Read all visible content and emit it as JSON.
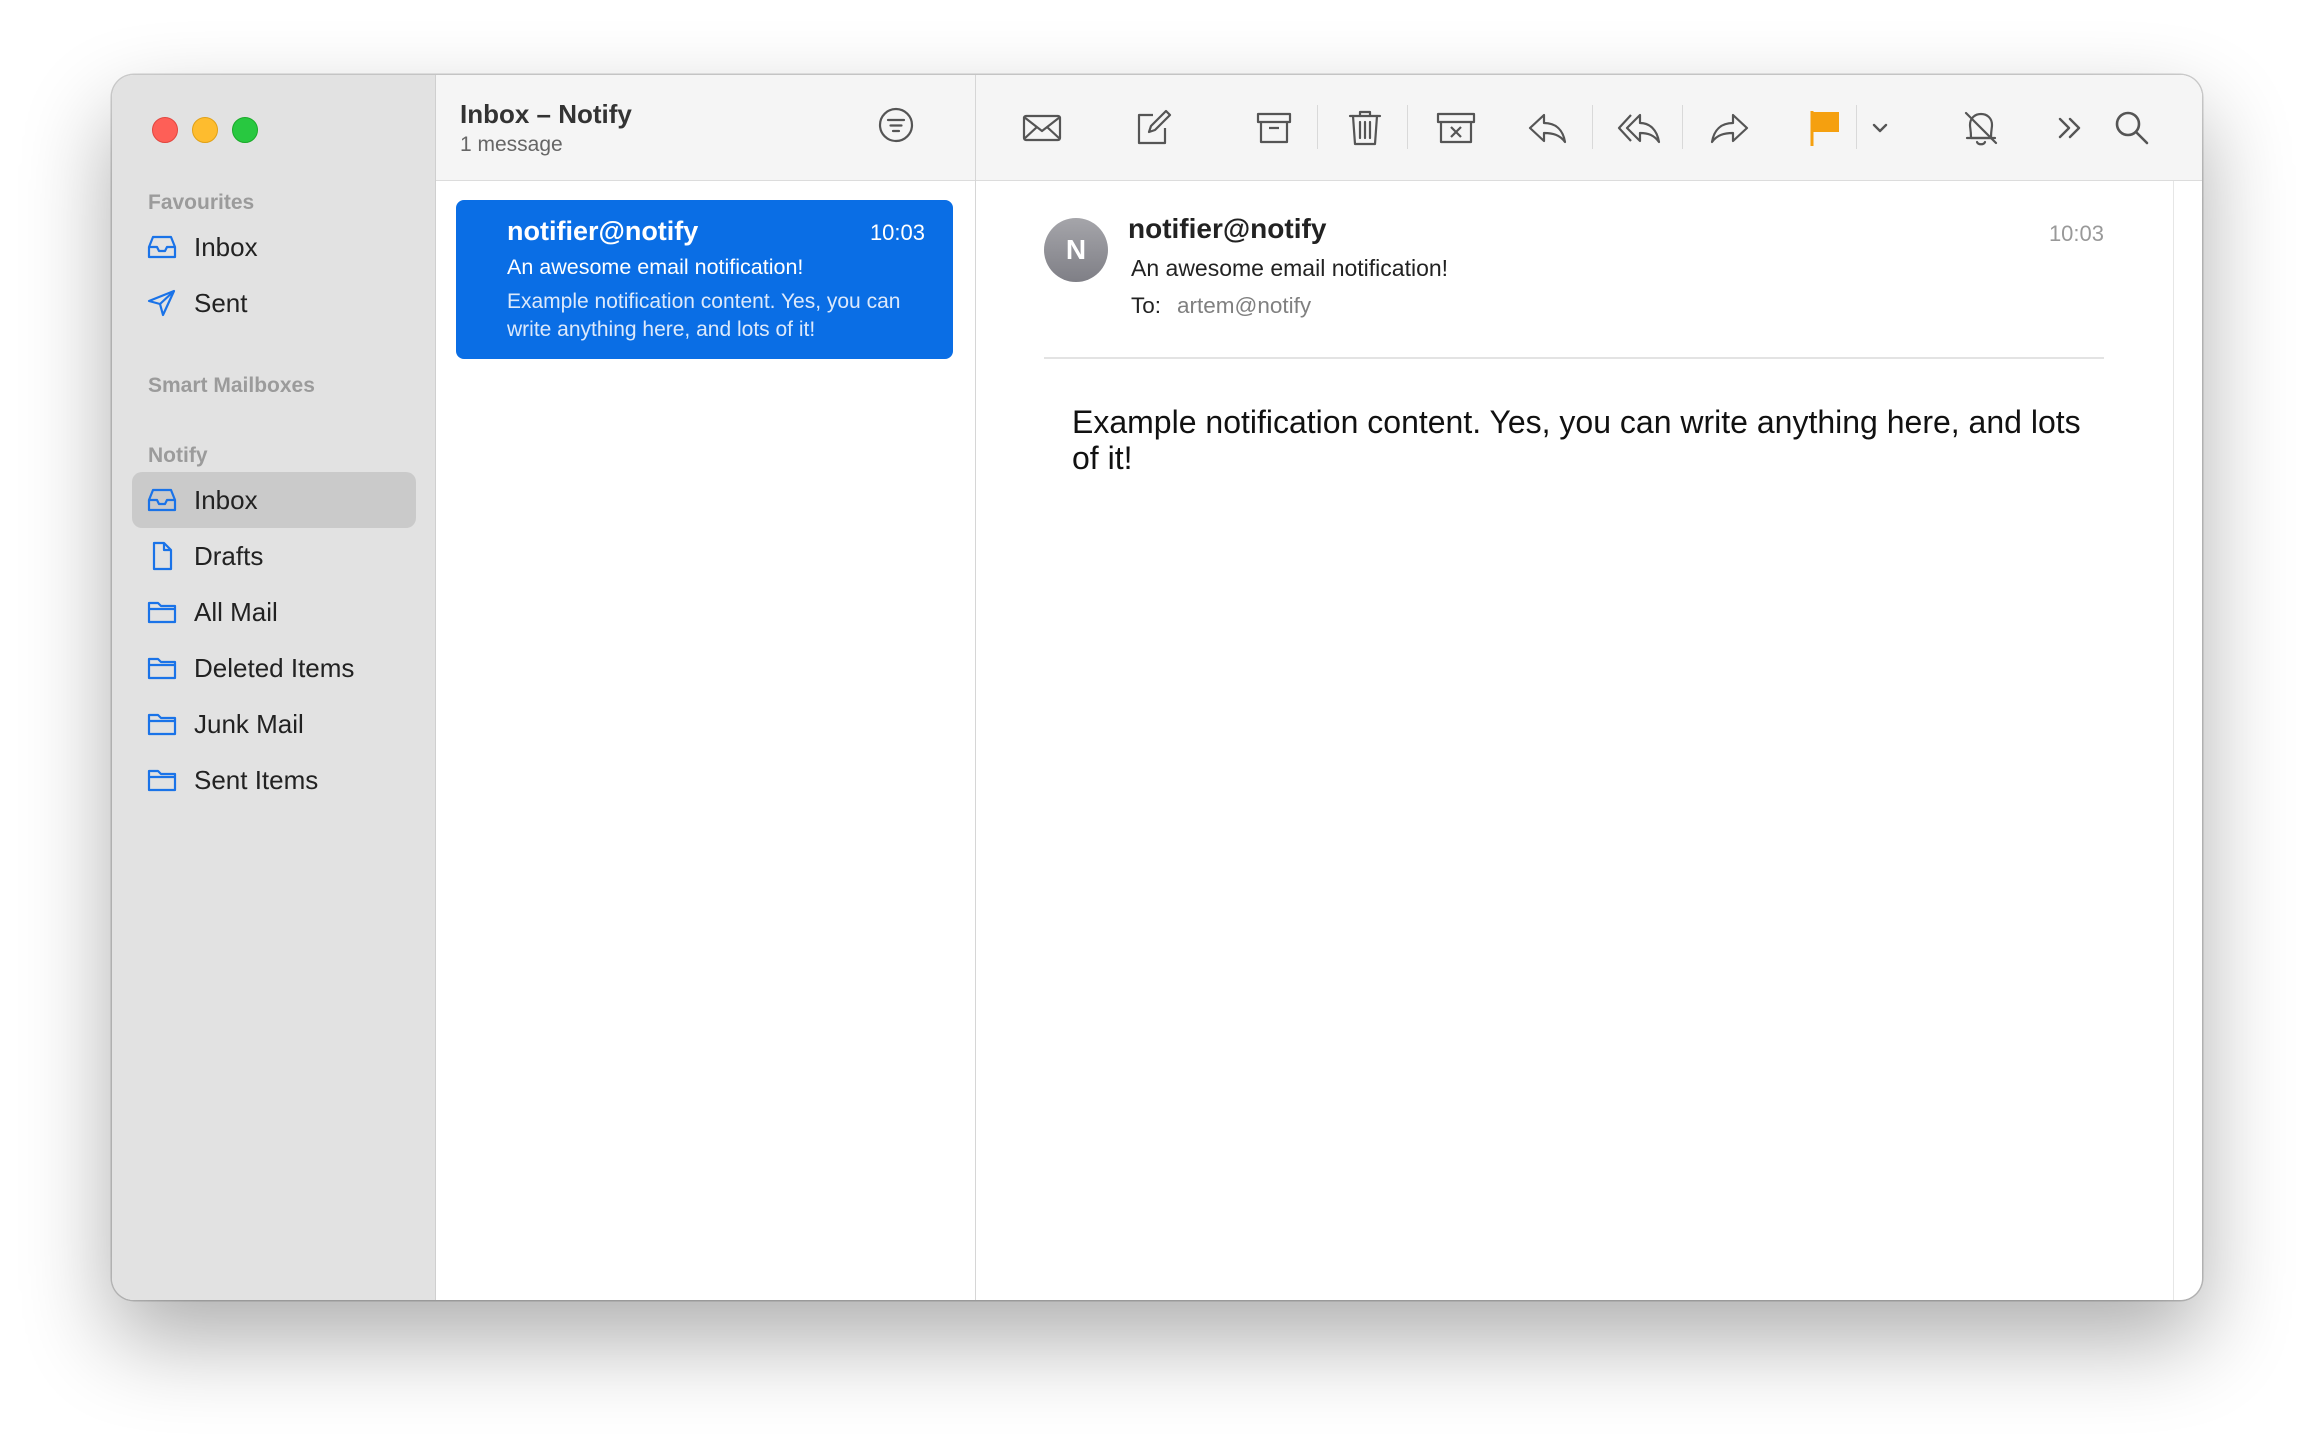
{
  "window": {
    "traffic_lights": [
      "close",
      "minimize",
      "zoom"
    ]
  },
  "sidebar": {
    "favourites_header": "Favourites",
    "favourites": [
      {
        "label": "Inbox",
        "icon": "inbox-icon"
      },
      {
        "label": "Sent",
        "icon": "paper-plane-icon"
      }
    ],
    "smart_header": "Smart Mailboxes",
    "account_header": "Notify",
    "account_items": [
      {
        "label": "Inbox",
        "icon": "inbox-icon",
        "selected": true
      },
      {
        "label": "Drafts",
        "icon": "document-icon"
      },
      {
        "label": "All Mail",
        "icon": "folder-icon"
      },
      {
        "label": "Deleted Items",
        "icon": "folder-icon"
      },
      {
        "label": "Junk Mail",
        "icon": "folder-icon"
      },
      {
        "label": "Sent Items",
        "icon": "folder-icon"
      }
    ]
  },
  "list": {
    "title": "Inbox – Notify",
    "subtitle": "1 message",
    "messages": [
      {
        "from": "notifier@notify",
        "time": "10:03",
        "subject": "An awesome email notification!",
        "preview": "Example notification content. Yes, you can write anything here, and lots of it!",
        "selected": true
      }
    ]
  },
  "toolbar": {
    "icons": [
      "envelope-icon",
      "compose-icon",
      "archive-icon",
      "trash-icon",
      "junk-icon",
      "reply-icon",
      "reply-all-icon",
      "forward-icon",
      "flag-icon",
      "chevron-down-icon",
      "bell-slash-icon",
      "overflow-icon",
      "search-icon"
    ],
    "flag_color": "#f5a00f"
  },
  "reader": {
    "avatar_initial": "N",
    "from": "notifier@notify",
    "time": "10:03",
    "subject": "An awesome email notification!",
    "to_label": "To:",
    "to_value": "artem@notify",
    "body": "Example notification content. Yes, you can write anything here, and lots of it!"
  },
  "colors": {
    "accent": "#0a6ee5",
    "sidebar_bg": "#e2e2e2",
    "sidebar_selected": "#cacaca",
    "icon_blue": "#1a73e8"
  }
}
